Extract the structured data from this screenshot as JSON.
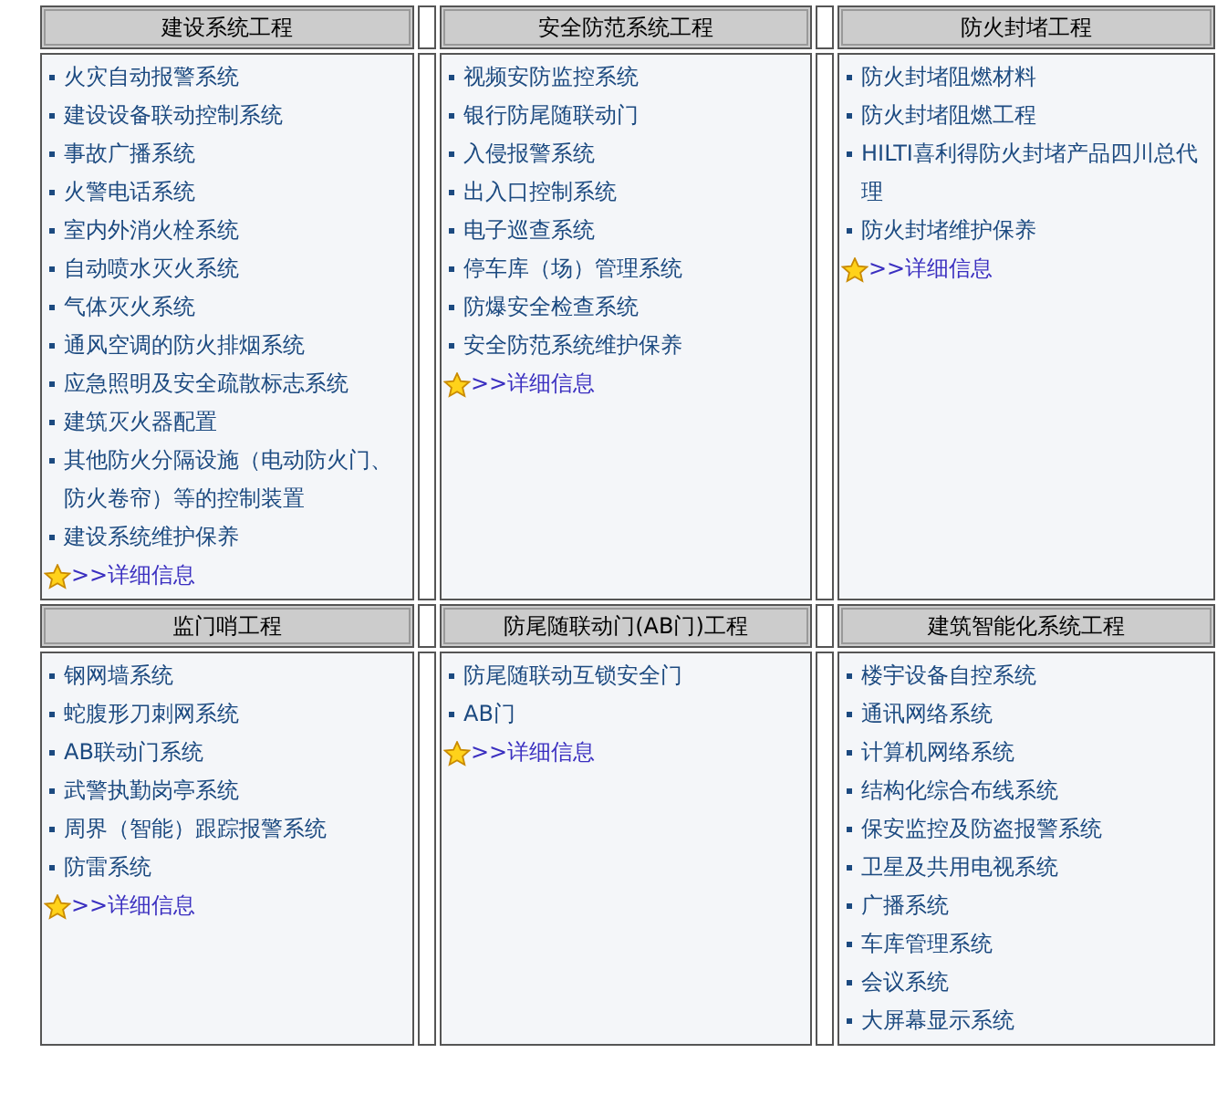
{
  "rows": [
    {
      "sections": [
        {
          "title": "建设系统工程",
          "items": [
            "火灾自动报警系统",
            "建设设备联动控制系统",
            "事故广播系统",
            "火警电话系统",
            "室内外消火栓系统",
            "自动喷水灭火系统",
            "气体灭火系统",
            "通风空调的防火排烟系统",
            "应急照明及安全疏散标志系统",
            "建筑灭火器配置",
            "其他防火分隔设施（电动防火门、防火卷帘）等的控制装置",
            "建设系统维护保养"
          ],
          "more": ">>详细信息"
        },
        {
          "title": "安全防范系统工程",
          "items": [
            "视频安防监控系统",
            "银行防尾随联动门",
            "入侵报警系统",
            "出入口控制系统",
            "电子巡查系统",
            "停车库（场）管理系统",
            "防爆安全检查系统",
            "安全防范系统维护保养"
          ],
          "more": ">>详细信息"
        },
        {
          "title": "防火封堵工程",
          "items": [
            "防火封堵阻燃材料",
            "防火封堵阻燃工程",
            "HILTI喜利得防火封堵产品四川总代理",
            "防火封堵维护保养"
          ],
          "more": ">>详细信息"
        }
      ]
    },
    {
      "sections": [
        {
          "title": "监门哨工程",
          "items": [
            "钢网墙系统",
            "蛇腹形刀刺网系统",
            "AB联动门系统",
            "武警执勤岗亭系统",
            "周界（智能）跟踪报警系统",
            "防雷系统"
          ],
          "more": ">>详细信息"
        },
        {
          "title": "防尾随联动门(AB门)工程",
          "items": [
            "防尾随联动互锁安全门",
            "AB门"
          ],
          "more": ">>详细信息"
        },
        {
          "title": "建筑智能化系统工程",
          "items": [
            "楼宇设备自控系统",
            "通讯网络系统",
            "计算机网络系统",
            "结构化综合布线系统",
            "保安监控及防盗报警系统",
            "卫星及共用电视系统",
            "广播系统",
            "车库管理系统",
            "会议系统",
            "大屏幕显示系统"
          ]
        }
      ]
    }
  ]
}
